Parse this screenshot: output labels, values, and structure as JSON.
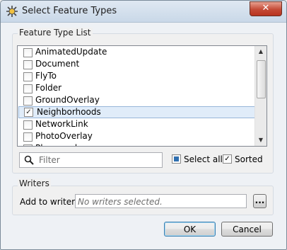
{
  "window": {
    "title": "Select Feature Types",
    "close_symbol": "✕",
    "icon": "fme-app-icon"
  },
  "feature_group": {
    "label": "Feature Type List",
    "items": [
      {
        "label": "AnimatedUpdate",
        "checked": false,
        "selected": false
      },
      {
        "label": "Document",
        "checked": false,
        "selected": false
      },
      {
        "label": "FlyTo",
        "checked": false,
        "selected": false
      },
      {
        "label": "Folder",
        "checked": false,
        "selected": false
      },
      {
        "label": "GroundOverlay",
        "checked": false,
        "selected": false
      },
      {
        "label": "Neighborhoods",
        "checked": true,
        "selected": true
      },
      {
        "label": "NetworkLink",
        "checked": false,
        "selected": false
      },
      {
        "label": "PhotoOverlay",
        "checked": false,
        "selected": false
      },
      {
        "label": "Placemark",
        "checked": false,
        "selected": false
      }
    ],
    "filter_placeholder": "Filter",
    "select_all_label": "Select all",
    "select_all_state": "indeterminate",
    "sorted_label": "Sorted",
    "sorted_checked": true
  },
  "writers_group": {
    "label": "Writers",
    "add_to_label": "Add to writers:",
    "writers_value": "No writers selected.",
    "browse_label": "..."
  },
  "buttons": {
    "ok": "OK",
    "cancel": "Cancel"
  },
  "colors": {
    "selection": "#e0ecf9",
    "title_bar": "#c9d8e8",
    "close_button": "#c44a36"
  }
}
